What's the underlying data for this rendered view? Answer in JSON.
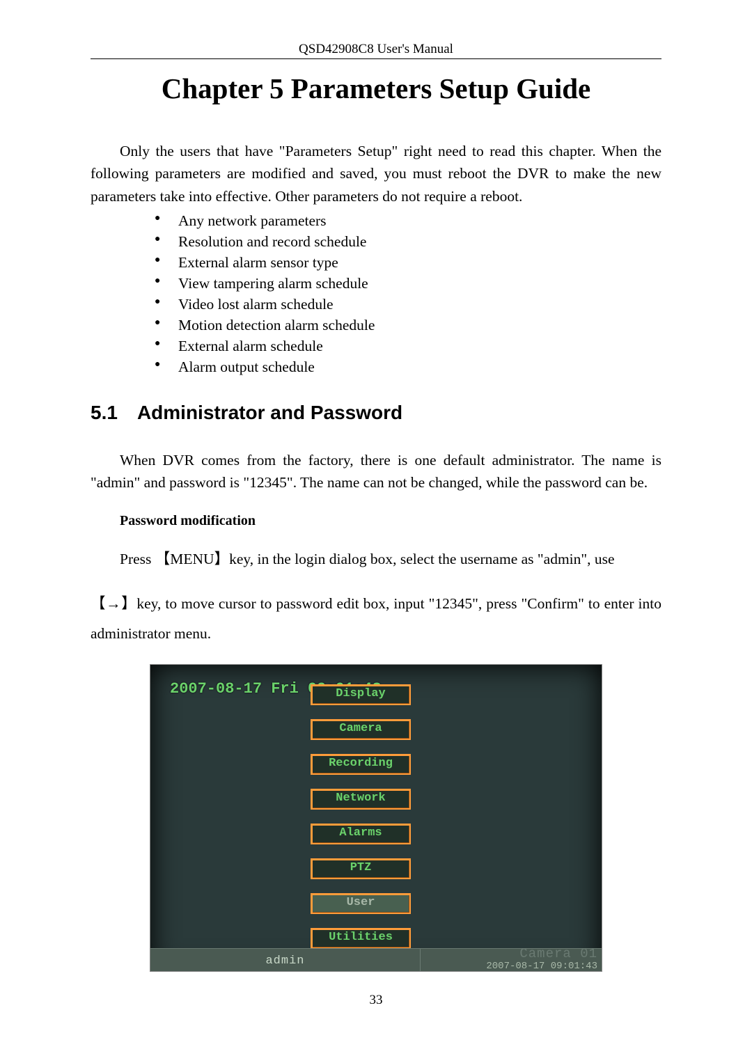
{
  "header": "QSD42908C8 User's Manual",
  "chapter": {
    "title": "Chapter 5  Parameters Setup Guide"
  },
  "intro": "Only the users that have \"Parameters Setup\" right need to read this chapter. When the following parameters are modified and saved, you must reboot the DVR to make the new parameters take into effective. Other parameters do not require a reboot.",
  "param_list": [
    "Any network parameters",
    "Resolution and record schedule",
    "External alarm sensor type",
    "View tampering alarm schedule",
    "Video lost alarm schedule",
    "Motion detection alarm schedule",
    "External alarm schedule",
    "Alarm output schedule"
  ],
  "section": {
    "number": "5.1",
    "title": "Administrator and Password"
  },
  "section_para": "When DVR comes from the factory, there is one default administrator. The name is \"admin\" and password is \"12345\". The name can not be changed, while the password can be.",
  "sub_heading": "Password modification",
  "pw_para1": "Press 【MENU】key, in the login dialog box, select the username as \"admin\", use",
  "pw_para2": "【→】key, to move cursor to password edit box, input \"12345\", press \"Confirm\" to enter into administrator menu.",
  "screenshot": {
    "datetime_overlay": "2007-08-17 Fri 09:01:43",
    "menu": [
      "Display",
      "Camera",
      "Recording",
      "Network",
      "Alarms",
      "PTZ",
      "User",
      "Utilities"
    ],
    "selected": "User",
    "footer_user": "admin",
    "footer_camera": "Camera 01",
    "footer_time": "2007-08-17 09:01:43"
  },
  "page_number": "33"
}
